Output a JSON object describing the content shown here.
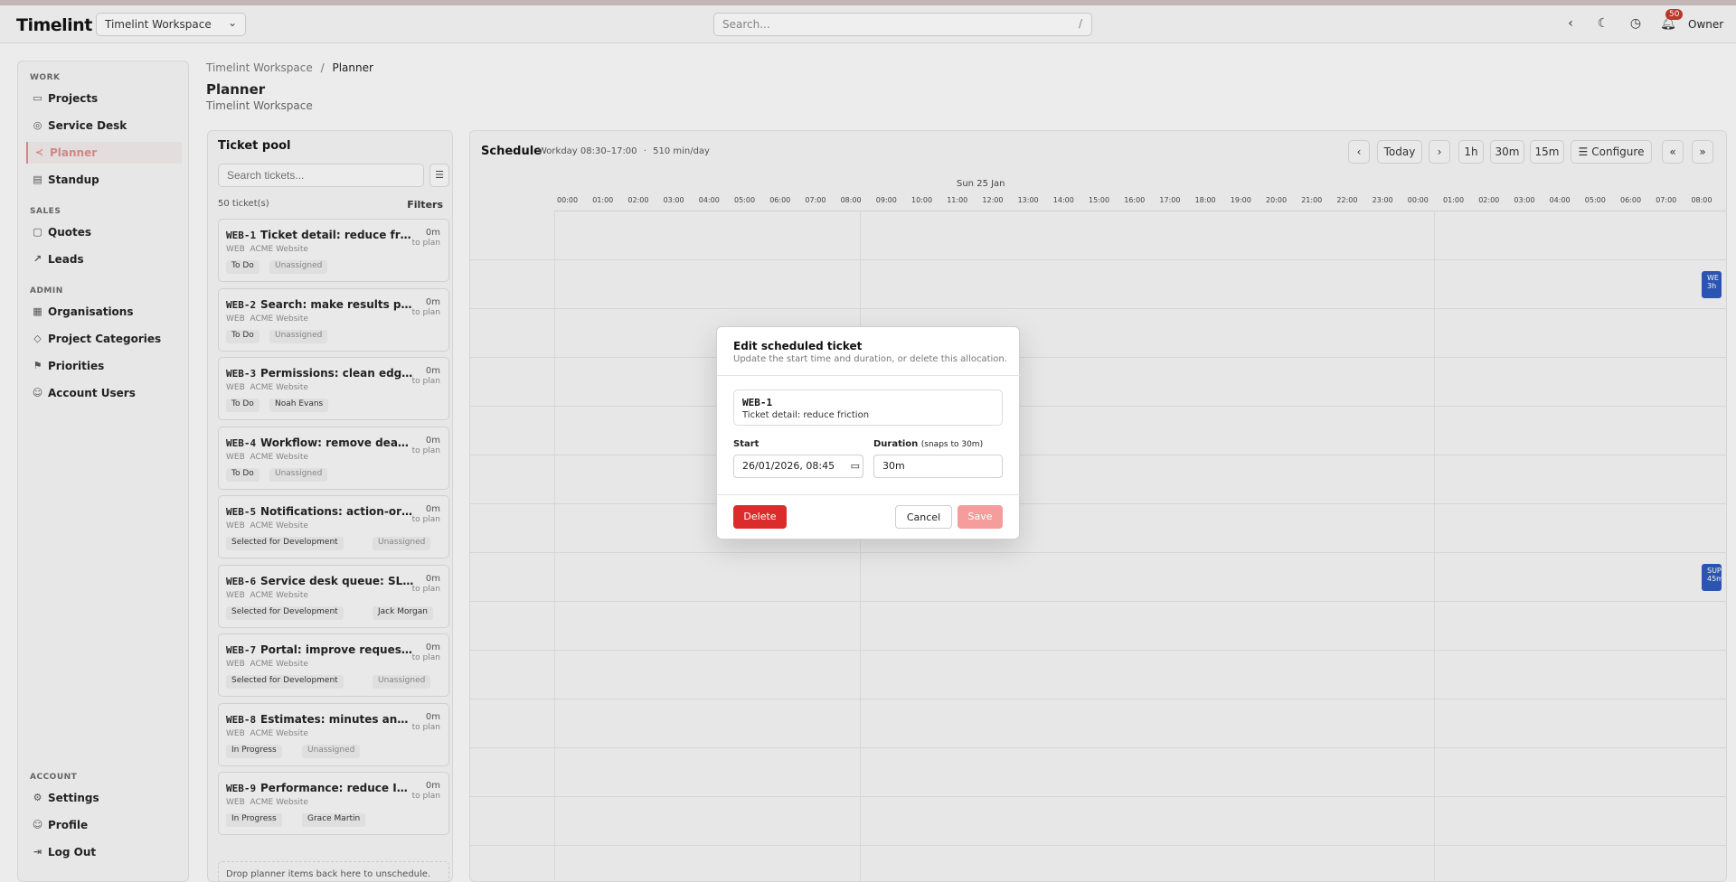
{
  "app": {
    "name": "Timelint",
    "workspace": "Timelint Workspace",
    "user": "Owner",
    "notif_count": "50"
  },
  "search": {
    "placeholder": "Search...",
    "shortcut": "/"
  },
  "sidebar": {
    "work": "WORK",
    "sales": "SALES",
    "admin": "ADMIN",
    "account": "ACCOUNT",
    "projects": "Projects",
    "service_desk": "Service Desk",
    "planner": "Planner",
    "standup": "Standup",
    "quotes": "Quotes",
    "leads": "Leads",
    "organisations": "Organisations",
    "project_categories": "Project Categories",
    "priorities": "Priorities",
    "account_users": "Account Users",
    "settings": "Settings",
    "profile": "Profile",
    "log_out": "Log Out"
  },
  "breadcrumb": {
    "root": "Timelint Workspace",
    "sep": "/",
    "current": "Planner"
  },
  "page": {
    "title": "Planner",
    "subtitle": "Timelint Workspace"
  },
  "pool": {
    "title": "Ticket pool",
    "search_placeholder": "Search tickets...",
    "count": "50 ticket(s)",
    "filters": "Filters",
    "drop_hint": "Drop planner items back here to unschedule.",
    "tickets": [
      {
        "key": "WEB-1",
        "title": "Ticket detail: reduce friction",
        "project_key": "WEB",
        "project": "ACME Website",
        "time": "0m",
        "plan": "to plan",
        "status": "To Do",
        "assignee": "Unassigned"
      },
      {
        "key": "WEB-2",
        "title": "Search: make results predict...",
        "project_key": "WEB",
        "project": "ACME Website",
        "time": "0m",
        "plan": "to plan",
        "status": "To Do",
        "assignee": "Unassigned"
      },
      {
        "key": "WEB-3",
        "title": "Permissions: clean edges",
        "project_key": "WEB",
        "project": "ACME Website",
        "time": "0m",
        "plan": "to plan",
        "status": "To Do",
        "assignee": "Noah Evans"
      },
      {
        "key": "WEB-4",
        "title": "Workflow: remove dead statu...",
        "project_key": "WEB",
        "project": "ACME Website",
        "time": "0m",
        "plan": "to plan",
        "status": "To Do",
        "assignee": "Unassigned"
      },
      {
        "key": "WEB-5",
        "title": "Notifications: action-oriented",
        "project_key": "WEB",
        "project": "ACME Website",
        "time": "0m",
        "plan": "to plan",
        "status": "Selected for Development",
        "assignee": "Unassigned"
      },
      {
        "key": "WEB-6",
        "title": "Service desk queue: SLA sorti...",
        "project_key": "WEB",
        "project": "ACME Website",
        "time": "0m",
        "plan": "to plan",
        "status": "Selected for Development",
        "assignee": "Jack Morgan"
      },
      {
        "key": "WEB-7",
        "title": "Portal: improve request intake",
        "project_key": "WEB",
        "project": "ACME Website",
        "time": "0m",
        "plan": "to plan",
        "status": "Selected for Development",
        "assignee": "Unassigned"
      },
      {
        "key": "WEB-8",
        "title": "Estimates: minutes and rema...",
        "project_key": "WEB",
        "project": "ACME Website",
        "time": "0m",
        "plan": "to plan",
        "status": "In Progress",
        "assignee": "Unassigned"
      },
      {
        "key": "WEB-9",
        "title": "Performance: reduce INP regr...",
        "project_key": "WEB",
        "project": "ACME Website",
        "time": "0m",
        "plan": "to plan",
        "status": "In Progress",
        "assignee": "Grace Martin"
      }
    ]
  },
  "schedule": {
    "title": "Schedule",
    "workday": "Workday 08:30–17:00",
    "dot": "·",
    "per_day": "510 min/day",
    "btn_today": "Today",
    "btn_1h": "1h",
    "btn_30m": "30m",
    "btn_15m": "15m",
    "btn_configure": "Configure",
    "date": "Sun 25 Jan",
    "hours": [
      "00:00",
      "01:00",
      "02:00",
      "03:00",
      "04:00",
      "05:00",
      "06:00",
      "07:00",
      "08:00",
      "09:00",
      "10:00",
      "11:00",
      "12:00",
      "13:00",
      "14:00",
      "15:00",
      "16:00",
      "17:00",
      "18:00",
      "19:00",
      "20:00",
      "21:00",
      "22:00",
      "23:00",
      "00:00",
      "01:00",
      "02:00",
      "03:00",
      "04:00",
      "05:00",
      "06:00",
      "07:00",
      "08:00"
    ],
    "blocks": [
      {
        "l1": "WE",
        "l2": "3h"
      },
      {
        "l1": "SUP",
        "l2": "45m"
      }
    ]
  },
  "modal": {
    "title": "Edit scheduled ticket",
    "subtitle": "Update the start time and duration, or delete this allocation.",
    "ticket_key": "WEB-1",
    "ticket_title": "Ticket detail: reduce friction",
    "start_label": "Start",
    "start_value": "26/01/2026, 08:45",
    "duration_label": "Duration",
    "duration_hint": "(snaps to 30m)",
    "duration_value": "30m",
    "delete": "Delete",
    "cancel": "Cancel",
    "save": "Save"
  },
  "colors": {
    "accent": "#d98a8a",
    "danger": "#dc2b2b",
    "save": "#f59c9c",
    "block": "#2c56b8"
  }
}
